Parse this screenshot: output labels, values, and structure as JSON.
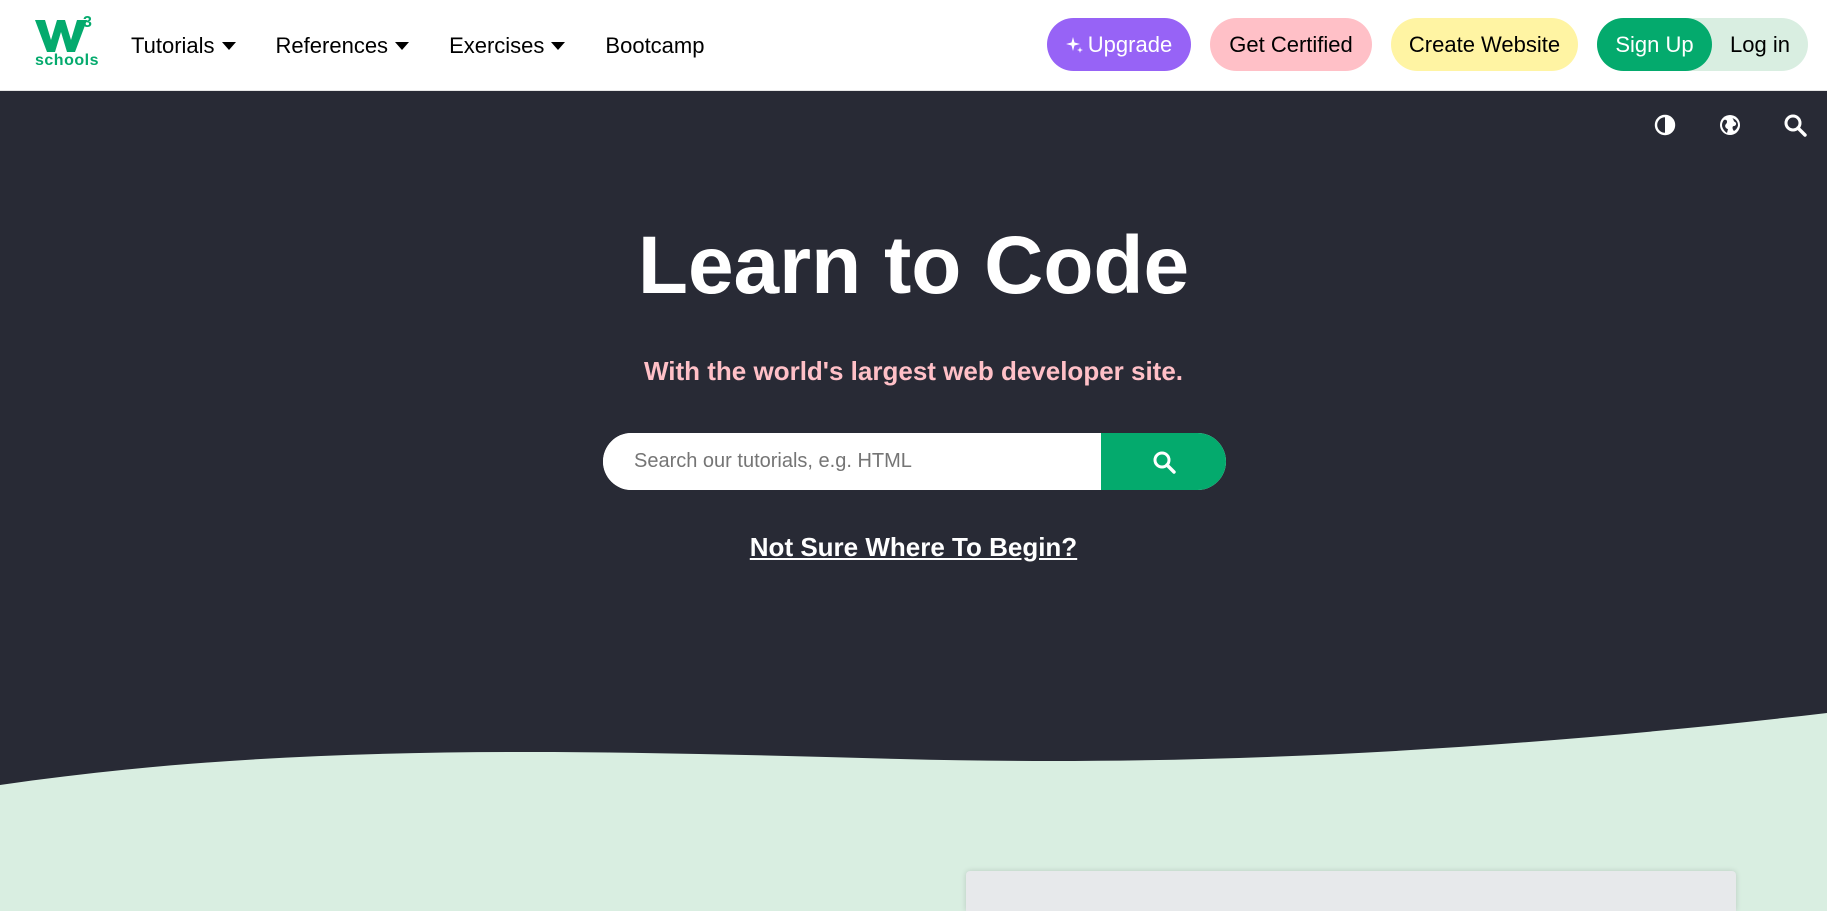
{
  "logo": {
    "mark": "W",
    "sup": "3",
    "text": "schools"
  },
  "nav": {
    "items": [
      {
        "label": "Tutorials",
        "dropdown": true
      },
      {
        "label": "References",
        "dropdown": true
      },
      {
        "label": "Exercises",
        "dropdown": true
      },
      {
        "label": "Bootcamp",
        "dropdown": false
      }
    ]
  },
  "actions": {
    "upgrade": "Upgrade",
    "certified": "Get Certified",
    "create": "Create Website",
    "signup": "Sign Up",
    "login": "Log in"
  },
  "utility_icons": [
    "contrast-icon",
    "globe-icon",
    "search-icon"
  ],
  "hero": {
    "title": "Learn to Code",
    "subtitle": "With the world's largest web developer site.",
    "search_placeholder": "Search our tutorials, e.g. HTML",
    "link": "Not Sure Where To Begin?"
  },
  "colors": {
    "brand_green": "#04aa6d",
    "hero_bg": "#282a35",
    "wave_bg": "#d9eee1",
    "upgrade_purple": "#9763f6",
    "certified_pink": "#ffc0c7",
    "create_yellow": "#fff4a3",
    "subtitle_pink": "#ffc0c7"
  }
}
